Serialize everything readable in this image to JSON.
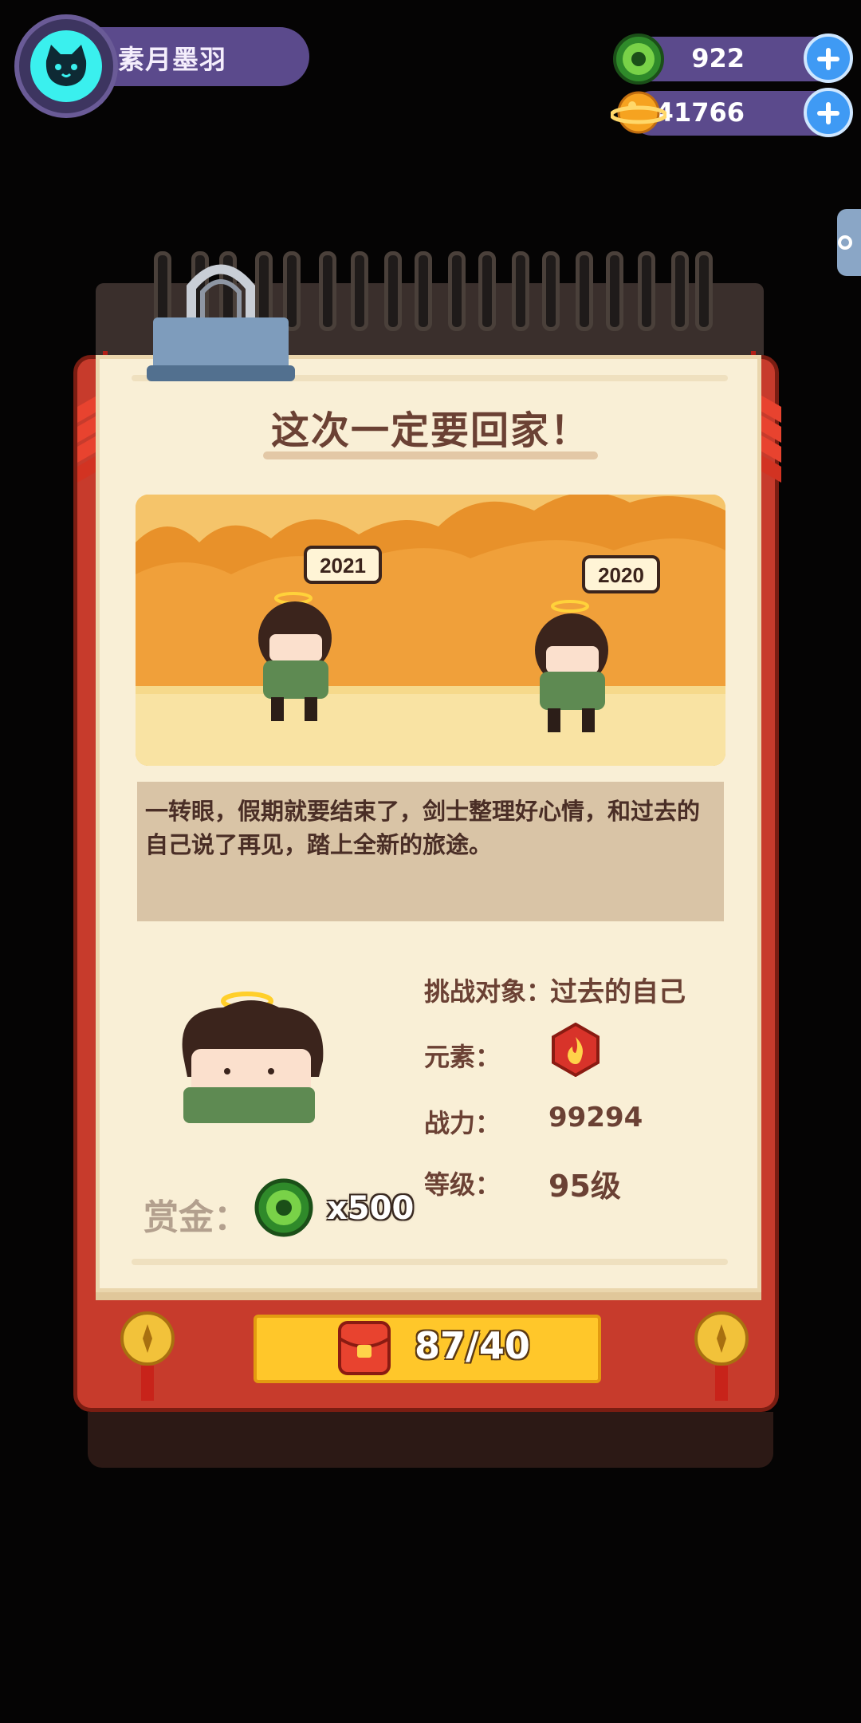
{
  "header": {
    "player_name": "素月墨羽",
    "currencies": [
      {
        "icon": "jade-coin-icon",
        "value": "922"
      },
      {
        "icon": "gold-planet-icon",
        "value": "341766"
      }
    ]
  },
  "challenge": {
    "title": "这次一定要回家！",
    "scene": {
      "year_tags": [
        "2021",
        "2020"
      ]
    },
    "story": "一转眼，假期就要结束了，剑士整理好心情，和过去的自己说了再见，踏上全新的旅途。",
    "stats": {
      "target_label": "挑战对象：",
      "target_value": "过去的自己",
      "element_label": "元素：",
      "element_icon": "fire-element-icon",
      "power_label": "战力：",
      "power_value": "99294",
      "level_label": "等级：",
      "level_value": "95级"
    },
    "reward": {
      "label": "赏金：",
      "icon": "jade-coin-icon",
      "quantity": "x500"
    },
    "action_button": {
      "icon": "red-envelope-icon",
      "label": "87/40"
    }
  },
  "colors": {
    "frame_red": "#c73b2c",
    "paper": "#f9efd6",
    "hud_purple": "#5b4a8c",
    "button_yellow": "#ffc72a",
    "text_brown": "#6b4134"
  }
}
